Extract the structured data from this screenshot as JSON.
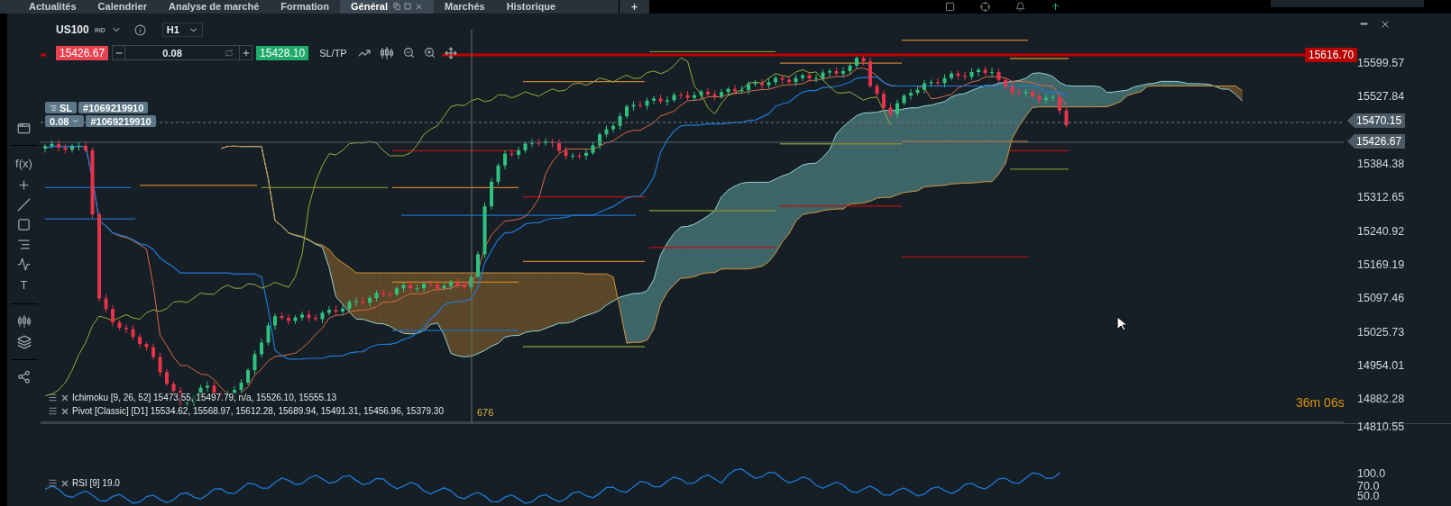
{
  "tabs": [
    {
      "label": "Actualités",
      "selected": false
    },
    {
      "label": "Calendrier",
      "selected": false
    },
    {
      "label": "Analyse de marché",
      "selected": false
    },
    {
      "label": "Formation",
      "selected": false
    },
    {
      "label": "Général",
      "selected": true
    },
    {
      "label": "Marchés",
      "selected": false
    },
    {
      "label": "Historique",
      "selected": false
    }
  ],
  "tab_add": "+",
  "symbol": {
    "name": "US100",
    "type": "IND",
    "timeframe": "H1"
  },
  "order": {
    "sell_price": "15426.67",
    "quantity": "0.08",
    "buy_price": "15428.10",
    "sltp": "SL/TP"
  },
  "positions": [
    {
      "kind": "stop",
      "label": "SL",
      "id": "#1069219910"
    },
    {
      "kind": "volume",
      "label": "0.08",
      "id": "#1069219910"
    }
  ],
  "toolbar_labels": [
    "f(x)",
    "T"
  ],
  "price_axis": [
    "15599.57",
    "15527.84",
    "15384.38",
    "15312.65",
    "15240.92",
    "15169.19",
    "15097.46",
    "15025.73",
    "14954.01",
    "14882.28",
    "14810.55"
  ],
  "price_badges": [
    {
      "kind": "alert",
      "value": "15616.70"
    },
    {
      "kind": "position",
      "value": "15470.15"
    },
    {
      "kind": "bid",
      "value": "15426.67"
    }
  ],
  "crosshair_label": "676",
  "countdown": "36m 06s",
  "indicators": [
    "Ichimoku [9, 26, 52] 15473.55, 15497.79, n/a, 15526.10, 15555.13",
    "Pivot [Classic] [D1] 15534.62, 15568.97, 15612.28, 15689.94, 15491.31, 15456.96, 15379.30"
  ],
  "rsi": {
    "legend": "RSI [9] 19.0",
    "axis": [
      "100.0",
      "70.0",
      "50.0"
    ]
  }
}
